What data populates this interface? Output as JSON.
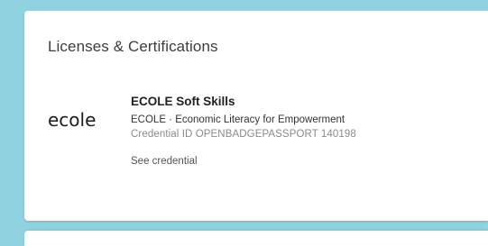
{
  "section": {
    "title": "Licenses & Certifications"
  },
  "certification": {
    "logo_text": "ecole",
    "name": "ECOLE Soft Skills",
    "issuer": "ECOLE · Economic Literacy for Empowerment",
    "credential_id": "Credential ID OPENBADGEPASSPORT 140198",
    "see_credential": "See credential"
  }
}
